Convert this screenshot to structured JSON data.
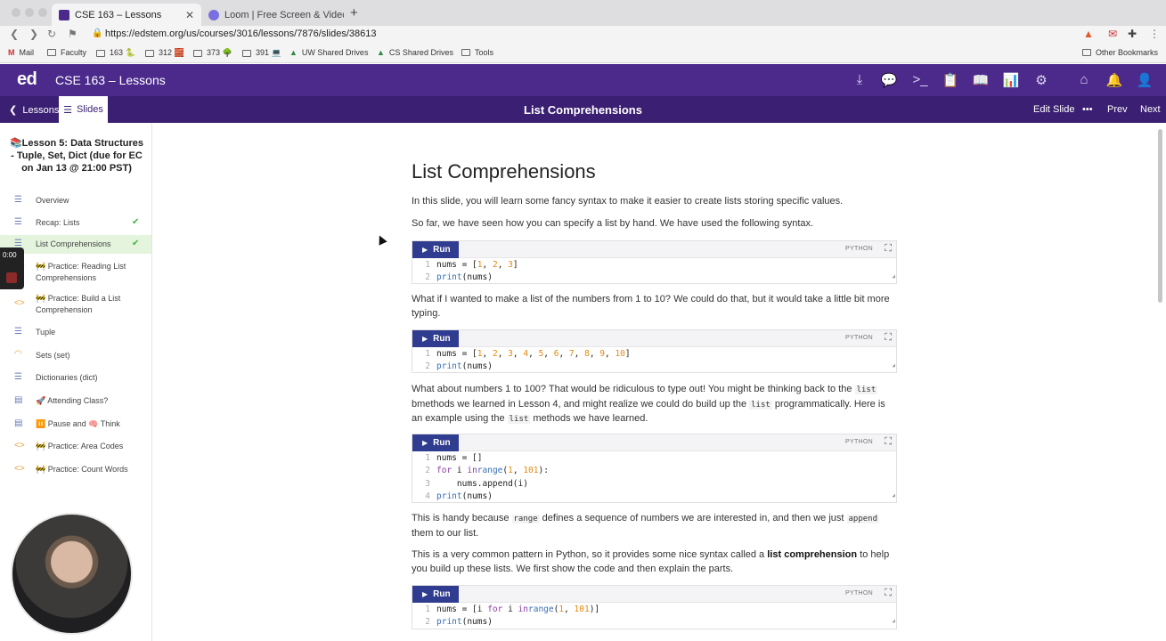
{
  "browser": {
    "tabs": [
      {
        "title": "CSE 163 – Lessons",
        "active": true
      },
      {
        "title": "Loom | Free Screen & Video Record",
        "active": false
      }
    ],
    "url": "https://edstem.org/us/courses/3016/lessons/7876/slides/38613",
    "bookmarks": [
      "Mail",
      "Faculty",
      "163 🐍",
      "312 🧱",
      "373 🌳",
      "391 💻",
      "UW Shared Drives",
      "CS Shared Drives",
      "Tools"
    ],
    "other_bookmarks": "Other Bookmarks"
  },
  "header": {
    "logo": "ed",
    "course": "CSE 163 – Lessons"
  },
  "subheader": {
    "back": "Lessons",
    "slides": "Slides",
    "title": "List Comprehensions",
    "edit": "Edit Slide",
    "more": "•••",
    "prev": "Prev",
    "next": "Next"
  },
  "sidebar": {
    "lesson_title": "📚Lesson 5: Data Structures - Tuple, Set, Dict (due for EC on Jan 13 @ 21:00 PST)",
    "items": [
      {
        "label": "Overview",
        "done": false
      },
      {
        "label": "Recap: Lists",
        "done": true
      },
      {
        "label": "List Comprehensions",
        "done": true
      },
      {
        "label": "🚧 Practice: Reading List Comprehensions",
        "done": false
      },
      {
        "label": "🚧 Practice: Build a List Comprehension",
        "done": false
      },
      {
        "label": "Tuple",
        "done": false
      },
      {
        "label": "Sets (set)",
        "done": false
      },
      {
        "label": "Dictionaries (dict)",
        "done": false
      },
      {
        "label": "🚀 Attending Class?",
        "done": false
      },
      {
        "label": "⏸️ Pause and 🧠 Think",
        "done": false
      },
      {
        "label": "🚧 Practice: Area Codes",
        "done": false
      },
      {
        "label": "🚧 Practice: Count Words",
        "done": false
      }
    ],
    "recorder_time": "0:00"
  },
  "content": {
    "heading": "List Comprehensions",
    "p1": "In this slide, you will learn some fancy syntax to make it easier to create lists storing specific values.",
    "p2": "So far, we have seen how you can specify a list by hand. We have used the following syntax.",
    "p3": "What if I wanted to make a list of the numbers from 1 to 10? We could do that, but it would take a little bit more typing.",
    "p4_a": "What about numbers 1 to 100? That would be ridiculous to type out! You might be thinking back to the",
    "p4_code1": "list",
    "p4_b": "bmethods we learned in Lesson 4, and might realize we could do build up the",
    "p4_code2": "list",
    "p4_c": "programmatically. Here is an example using the",
    "p4_code3": "list",
    "p4_d": "methods we have learned.",
    "p5_a": "This is handy because",
    "p5_code1": "range",
    "p5_b": "defines a sequence of numbers we are interested in, and then we just",
    "p5_code2": "append",
    "p5_c": "them to our list.",
    "p6_a": "This is a very common pattern in Python, so it provides some nice syntax called a",
    "p6_bold": "list comprehension",
    "p6_b": "to help you build up these lists. We first show the code and then explain the parts.",
    "run_label": "Run",
    "lang_label": "PYTHON"
  }
}
